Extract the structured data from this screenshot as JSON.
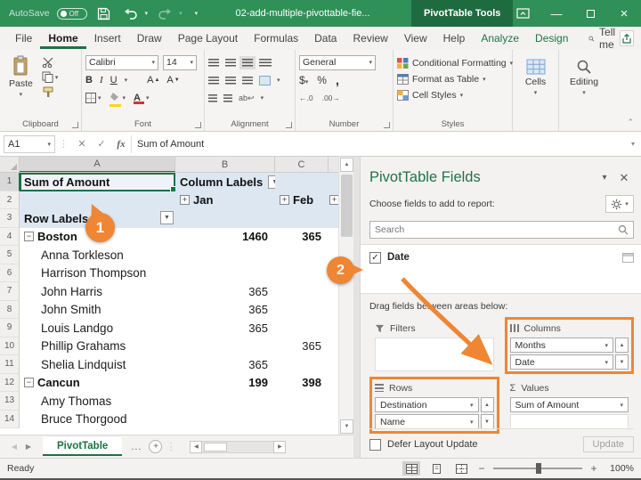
{
  "colors": {
    "excel_green": "#217346",
    "titlebar_green": "#2F9058",
    "contextual_green": "#1E6B40",
    "accent_orange": "#ED7D31",
    "pivot_header_blue": "#DCE7F2"
  },
  "titlebar": {
    "autosave_label": "AutoSave",
    "autosave_state": "Off",
    "filename": "02-add-multiple-pivottable-fie...",
    "context_tab": "PivotTable Tools"
  },
  "menubar": {
    "tabs": [
      "File",
      "Home",
      "Insert",
      "Draw",
      "Page Layout",
      "Formulas",
      "Data",
      "Review",
      "View",
      "Help",
      "Analyze",
      "Design"
    ],
    "active_index": 1,
    "contextual_indexes": [
      10,
      11
    ],
    "tellme_label": "Tell me"
  },
  "ribbon": {
    "clipboard": {
      "label": "Clipboard",
      "paste_label": "Paste"
    },
    "font": {
      "label": "Font",
      "family": "Calibri",
      "size": "14",
      "bold": "B",
      "italic": "I",
      "underline": "U"
    },
    "alignment": {
      "label": "Alignment"
    },
    "number": {
      "label": "Number",
      "format": "General",
      "currency": "$",
      "percent": "%",
      "comma": ","
    },
    "styles": {
      "label": "Styles",
      "conditional_formatting": "Conditional Formatting",
      "format_as_table": "Format as Table",
      "cell_styles": "Cell Styles"
    },
    "cells": {
      "label": "Cells"
    },
    "editing": {
      "label": "Editing"
    }
  },
  "formula_bar": {
    "cell_reference": "A1",
    "fx_label": "fx",
    "formula": "Sum of Amount"
  },
  "grid": {
    "column_headers": [
      "A",
      "B",
      "C"
    ],
    "rows": [
      {
        "n": "1",
        "blue": true,
        "a": {
          "t": "Sum of Amount",
          "bold": true,
          "selected": true
        },
        "b": {
          "t": "Column Labels",
          "bold": true,
          "filter": true
        },
        "c": {
          "t": ""
        }
      },
      {
        "n": "2",
        "blue": true,
        "a": {
          "t": ""
        },
        "b": {
          "t": "Jan",
          "bold": true,
          "expand": "+"
        },
        "c": {
          "t": "Feb",
          "bold": true,
          "expand": "+"
        },
        "fExpand": "+"
      },
      {
        "n": "3",
        "blue": true,
        "a": {
          "t": "Row Labels",
          "bold": true,
          "filter": true
        },
        "b": {
          "t": ""
        },
        "c": {
          "t": ""
        }
      },
      {
        "n": "4",
        "a": {
          "t": "Boston",
          "bold": true,
          "collapse": "-"
        },
        "b": {
          "t": "1460",
          "bold": true,
          "num": true
        },
        "c": {
          "t": "365",
          "bold": true,
          "num": true
        }
      },
      {
        "n": "5",
        "a": {
          "t": "Anna Torkleson",
          "indent": true
        },
        "b": {
          "t": ""
        },
        "c": {
          "t": ""
        }
      },
      {
        "n": "6",
        "a": {
          "t": "Harrison Thompson",
          "indent": true
        },
        "b": {
          "t": ""
        },
        "c": {
          "t": ""
        }
      },
      {
        "n": "7",
        "a": {
          "t": "John Harris",
          "indent": true
        },
        "b": {
          "t": "365",
          "num": true
        },
        "c": {
          "t": ""
        }
      },
      {
        "n": "8",
        "a": {
          "t": "John Smith",
          "indent": true
        },
        "b": {
          "t": "365",
          "num": true
        },
        "c": {
          "t": ""
        }
      },
      {
        "n": "9",
        "a": {
          "t": "Louis Landgo",
          "indent": true
        },
        "b": {
          "t": "365",
          "num": true
        },
        "c": {
          "t": ""
        }
      },
      {
        "n": "10",
        "a": {
          "t": "Phillip Grahams",
          "indent": true
        },
        "b": {
          "t": ""
        },
        "c": {
          "t": "365",
          "num": true
        }
      },
      {
        "n": "11",
        "a": {
          "t": "Shelia Lindquist",
          "indent": true
        },
        "b": {
          "t": "365",
          "num": true
        },
        "c": {
          "t": ""
        }
      },
      {
        "n": "12",
        "a": {
          "t": "Cancun",
          "bold": true,
          "collapse": "-"
        },
        "b": {
          "t": "199",
          "bold": true,
          "num": true
        },
        "c": {
          "t": "398",
          "bold": true,
          "num": true
        }
      },
      {
        "n": "13",
        "a": {
          "t": "Amy Thomas",
          "indent": true
        },
        "b": {
          "t": ""
        },
        "c": {
          "t": ""
        }
      },
      {
        "n": "14",
        "a": {
          "t": "Bruce Thorgood",
          "indent": true
        },
        "b": {
          "t": ""
        },
        "c": {
          "t": ""
        }
      }
    ]
  },
  "callouts": {
    "step1": "1",
    "step2": "2"
  },
  "fields_pane": {
    "title": "PivotTable Fields",
    "choose_label": "Choose fields to add to report:",
    "search_placeholder": "Search",
    "fields": [
      {
        "name": "Date",
        "checked": true
      }
    ],
    "drag_hint": "Drag fields between areas below:",
    "areas": {
      "filters": {
        "label": "Filters",
        "items": []
      },
      "columns": {
        "label": "Columns",
        "items": [
          "Months",
          "Date"
        ],
        "highlighted": true
      },
      "rows": {
        "label": "Rows",
        "items": [
          "Destination",
          "Name"
        ],
        "highlighted": true
      },
      "values": {
        "label": "Values",
        "items": [
          "Sum of Amount"
        ]
      }
    },
    "defer_label": "Defer Layout Update",
    "update_label": "Update"
  },
  "sheet_bar": {
    "tab_name": "PivotTable",
    "more_tabs": "..."
  },
  "status_bar": {
    "status": "Ready",
    "zoom_level": "100%"
  }
}
